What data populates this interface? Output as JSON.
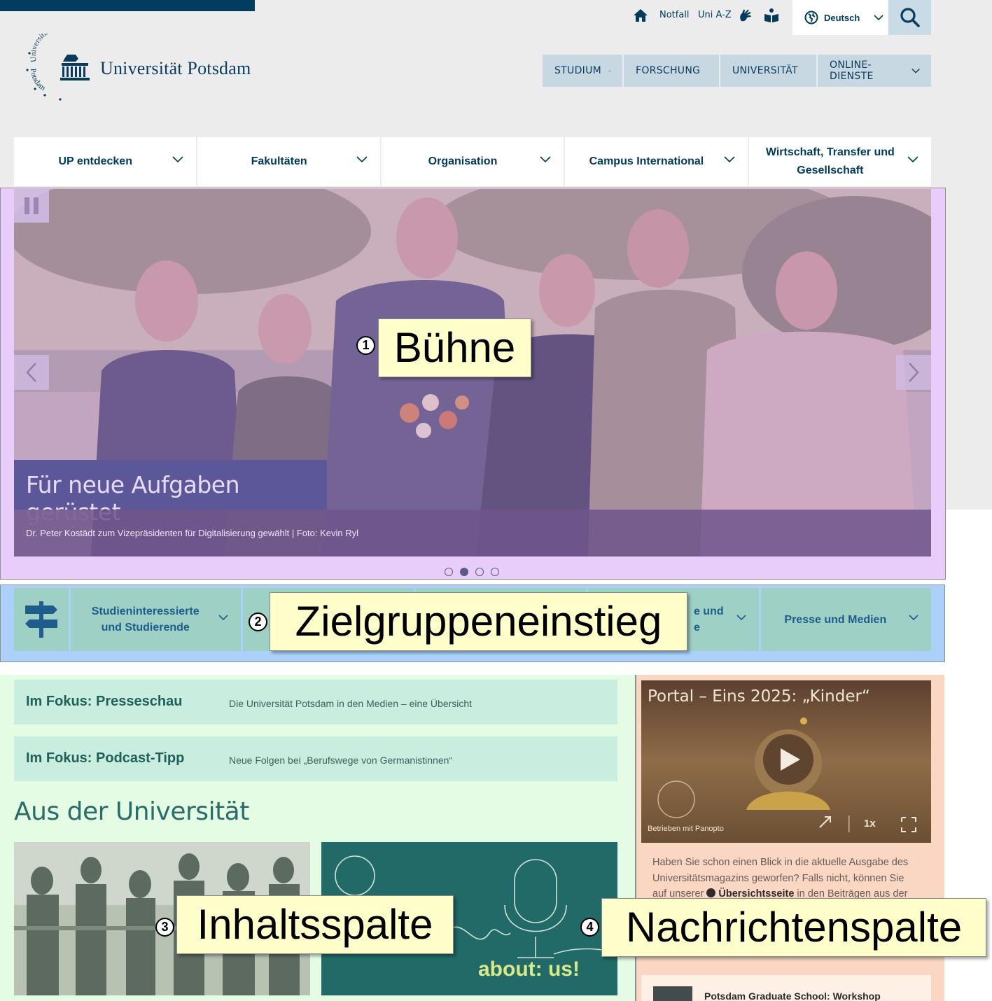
{
  "service_nav": {
    "notfall": "Notfall",
    "uni_az": "Uni A-Z",
    "language": "Deutsch",
    "icons": [
      "home-icon",
      "sign-language-icon",
      "easy-language-icon",
      "globe-icon",
      "search-icon"
    ]
  },
  "logo": {
    "name": "Universität Potsdam",
    "seal_arc_top": "Universität",
    "seal_arc_bottom": "Potsdam"
  },
  "main_nav": [
    "STUDIUM",
    "FORSCHUNG",
    "UNIVERSITÄT",
    "ONLINE-DIENSTE"
  ],
  "sub_nav": [
    "UP entdecken",
    "Fakultäten",
    "Organisation",
    "Campus International",
    "Wirtschaft, Transfer und Gesellschaft"
  ],
  "stage": {
    "title": "Für neue Aufgaben gerüstet",
    "caption": "Dr. Peter Kostädt zum Vizepräsidenten für Digitalisierung gewählt | Foto: Kevin Ryl",
    "slide_count": 4,
    "active_slide": 2
  },
  "target_groups": {
    "items": [
      "Studieninteressierte und Studierende",
      "",
      "",
      "e und\ne",
      "Presse und Medien"
    ]
  },
  "content": {
    "focus": [
      {
        "title": "Im Fokus: Presseschau",
        "desc": "Die Universität Potsdam in den Medien – eine Übersicht"
      },
      {
        "title": "Im Fokus: Podcast-Tipp",
        "desc": "Neue Folgen bei „Berufswege von Germanistinnen“"
      }
    ],
    "section_title": "Aus der Universität",
    "card2_text": "about: us!"
  },
  "news": {
    "video_title": "Portal – Eins 2025: „Kinder“",
    "powered_by": "Betrieben mit Panopto",
    "speed": "1x",
    "text_before": "Haben Sie schon einen Blick in die aktuelle Ausgabe des Universitätsmagazins geworfen? Falls nicht, können Sie auf unserer ",
    "text_link": "Übersichtsseite",
    "text_after": " in den Beiträgen aus der",
    "item_title": "Potsdam Graduate School: Workshop"
  },
  "callouts": [
    {
      "number": "1",
      "label": "Bühne"
    },
    {
      "number": "2",
      "label": "Zielgruppeneinstieg"
    },
    {
      "number": "3",
      "label": "Inhaltsspalte"
    },
    {
      "number": "4",
      "label": "Nachrichtenspalte"
    }
  ],
  "colors": {
    "brand_navy": "#023d5f",
    "stage_zone": "#e8cdfb",
    "target_zone": "#abd1fb",
    "content_zone": "#e4fbe4",
    "news_zone": "#f9d7c3",
    "callout_bg": "#ffffcc"
  }
}
